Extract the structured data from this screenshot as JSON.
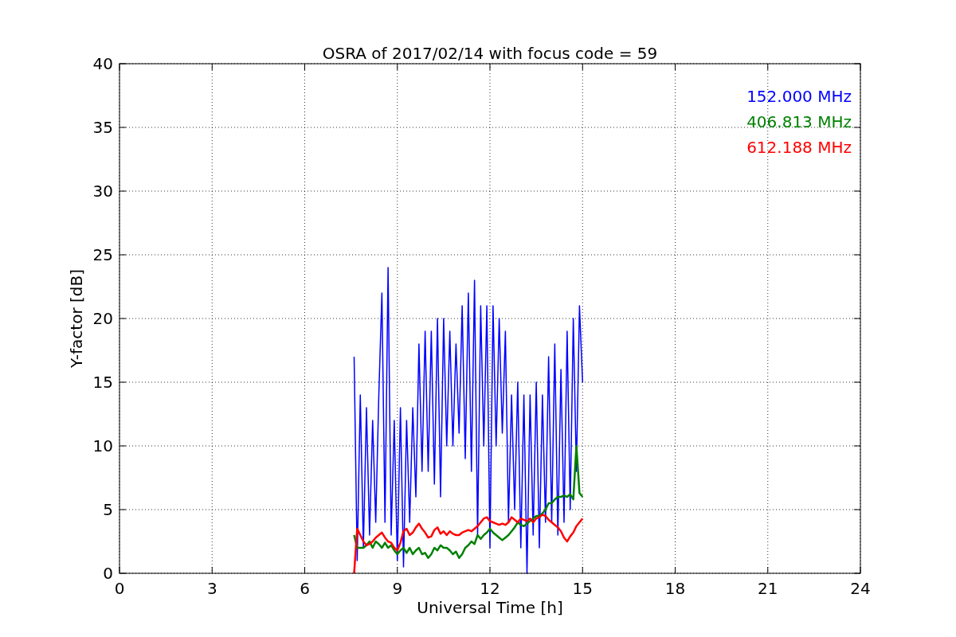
{
  "chart_data": {
    "type": "line",
    "title": "OSRA of 2017/02/14 with focus code = 59",
    "xlabel": "Universal Time [h]",
    "ylabel": "Y-factor [dB]",
    "xlim": [
      0,
      24
    ],
    "ylim": [
      0,
      40
    ],
    "xticks": [
      0,
      3,
      6,
      9,
      12,
      15,
      18,
      21,
      24
    ],
    "yticks": [
      0,
      5,
      10,
      15,
      20,
      25,
      30,
      35,
      40
    ],
    "grid": true,
    "x": [
      7.6,
      7.7,
      7.8,
      7.9,
      8.0,
      8.1,
      8.2,
      8.3,
      8.4,
      8.5,
      8.6,
      8.7,
      8.8,
      8.9,
      9.0,
      9.1,
      9.2,
      9.3,
      9.4,
      9.5,
      9.6,
      9.7,
      9.8,
      9.9,
      10.0,
      10.1,
      10.2,
      10.3,
      10.4,
      10.5,
      10.6,
      10.7,
      10.8,
      10.9,
      11.0,
      11.1,
      11.2,
      11.3,
      11.4,
      11.5,
      11.6,
      11.7,
      11.8,
      11.9,
      12.0,
      12.1,
      12.2,
      12.3,
      12.4,
      12.5,
      12.6,
      12.7,
      12.8,
      12.9,
      13.0,
      13.1,
      13.2,
      13.3,
      13.4,
      13.5,
      13.6,
      13.7,
      13.8,
      13.9,
      14.0,
      14.1,
      14.2,
      14.3,
      14.4,
      14.5,
      14.6,
      14.7,
      14.8,
      14.9,
      15.0
    ],
    "series": [
      {
        "name": "152.000 MHz",
        "color": "#0000ff",
        "values": [
          17,
          1,
          14,
          2,
          13,
          3,
          12,
          4,
          14,
          22,
          4,
          24,
          3,
          12,
          1,
          13,
          0.5,
          12,
          4,
          13,
          6,
          18,
          8,
          19,
          8,
          19,
          7,
          20,
          6,
          20,
          10,
          19,
          10,
          18,
          11,
          21,
          9,
          22,
          8,
          23,
          3,
          21,
          10,
          21,
          2,
          21,
          10,
          20,
          11,
          19,
          4,
          14,
          5,
          15,
          2,
          14,
          0,
          14,
          3,
          15,
          2,
          14,
          4,
          17,
          4,
          18,
          3,
          16,
          4,
          19,
          5,
          20,
          8,
          21,
          15
        ]
      },
      {
        "name": "406.813 MHz",
        "color": "#008000",
        "values": [
          3,
          2,
          2,
          2,
          2.2,
          2.5,
          2,
          2.5,
          2.3,
          2,
          2.4,
          2,
          2.2,
          1.8,
          1.5,
          1.8,
          2,
          1.6,
          2,
          1.5,
          1.8,
          2,
          1.5,
          1.6,
          1.2,
          1.5,
          2,
          1.8,
          2.2,
          2,
          2,
          1.8,
          1.5,
          1.7,
          1.2,
          1.5,
          2,
          2.2,
          2.5,
          2.3,
          3,
          2.7,
          3,
          3.2,
          3.5,
          3.2,
          3,
          2.8,
          2.6,
          2.8,
          3,
          3.3,
          3.6,
          4,
          3.8,
          3.7,
          3.9,
          4.1,
          4.3,
          4.5,
          4.5,
          4.7,
          5,
          5.5,
          5.5,
          5.8,
          6,
          6,
          6.1,
          6,
          6.2,
          5.8,
          10,
          6.3,
          6
        ]
      },
      {
        "name": "612.188 MHz",
        "color": "#ff0000",
        "values": [
          0,
          3.5,
          3,
          2.5,
          2.2,
          2.3,
          2.5,
          2.8,
          3,
          3.2,
          2.8,
          2.5,
          2.4,
          2,
          1.8,
          2.4,
          3.3,
          3.5,
          3,
          3.2,
          3.6,
          3.9,
          3.5,
          3.2,
          2.8,
          2.9,
          3.4,
          3.6,
          3.1,
          3.3,
          3,
          3.3,
          3.1,
          3,
          3,
          3.2,
          3.3,
          3.4,
          3.3,
          3.5,
          3.7,
          4,
          4.3,
          4.4,
          4.1,
          4,
          3.9,
          3.8,
          3.9,
          3.8,
          4,
          4.4,
          4.2,
          4,
          4.3,
          4.2,
          4.1,
          4.3,
          4,
          4.3,
          4.4,
          4.6,
          4.5,
          4.2,
          4,
          3.8,
          3.6,
          3.3,
          2.8,
          2.5,
          2.9,
          3.2,
          3.7,
          4,
          4.3
        ]
      }
    ]
  }
}
